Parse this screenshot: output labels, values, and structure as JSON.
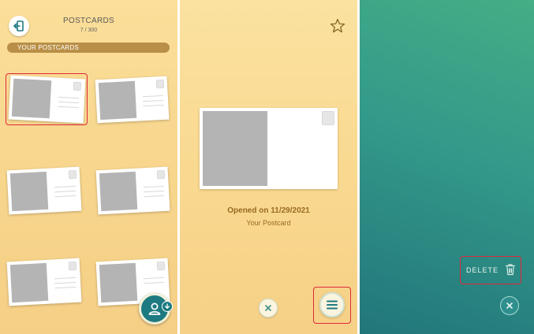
{
  "collection": {
    "title": "POSTCARDS",
    "count": "7 / 300",
    "section_label": "YOUR POSTCARDS"
  },
  "detail": {
    "opened_text": "Opened on 11/29/2021",
    "sender_text": "Your Postcard"
  },
  "actions": {
    "delete_label": "DELETE"
  },
  "icons": {
    "back": "exit-door-icon",
    "friend": "friend-profile-icon",
    "favorite": "star-outline-icon",
    "close": "close-x-icon",
    "menu": "hamburger-menu-icon",
    "delete": "trash-can-icon"
  },
  "colors": {
    "accent_teal": "#1d7a80",
    "section_bar": "#b98f47",
    "detail_text": "#9a6a24",
    "highlight_red": "#e0283a"
  }
}
